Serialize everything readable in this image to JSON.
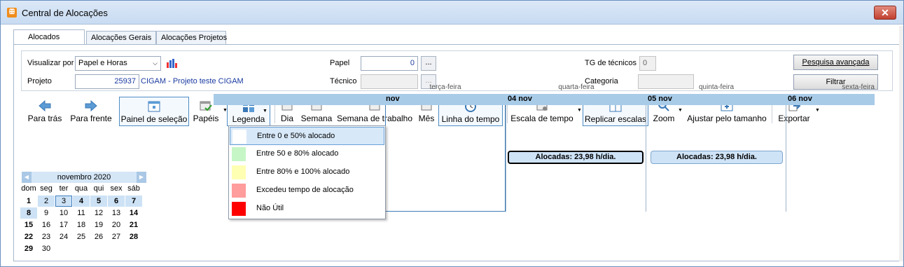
{
  "window": {
    "title": "Central de Alocações",
    "app_icon": "cigam-app-icon",
    "close_label": "✕"
  },
  "tabs": [
    {
      "label": "Alocados",
      "active": true
    },
    {
      "label": "Alocações Gerais",
      "active": false
    },
    {
      "label": "Alocações Projetos",
      "active": false
    }
  ],
  "filters": {
    "visualizar_label": "Visualizar por",
    "visualizar_value": "Papel e Horas",
    "projeto_label": "Projeto",
    "projeto_value": "25937",
    "projeto_name": "CIGAM - Projeto teste CIGAM",
    "papel_label": "Papel",
    "papel_value": "0",
    "tecnico_label": "Técnico",
    "tecnico_value": "",
    "ellipsis": "...",
    "tg_label": "TG de técnicos",
    "tg_value": "0",
    "categoria_label": "Categoria",
    "categoria_value": "",
    "pesquisa_button": "Pesquisa avançada",
    "filtrar_button": "Filtrar"
  },
  "toolbar": {
    "para_tras": "Para trás",
    "para_frente": "Para frente",
    "painel": "Painel de seleção",
    "papeis": "Papéis",
    "legenda": "Legenda",
    "dia": "Dia",
    "semana": "Semana",
    "semana_trabalho": "Semana de trabalho",
    "mes": "Mês",
    "linha_tempo": "Linha do tempo",
    "escala_tempo": "Escala de tempo",
    "replicar_escalas": "Replicar escalas",
    "zoom": "Zoom",
    "ajustar": "Ajustar pelo tamanho",
    "exportar": "Exportar"
  },
  "schedule": {
    "weekdays": [
      "terça-feira",
      "quarta-feira",
      "quinta-feira",
      "sexta-feira"
    ],
    "days": [
      "nov",
      "04 nov",
      "05 nov",
      "06 nov"
    ],
    "allocations": [
      "Alocadas: 23,98 h/dia.",
      "Alocadas: 23,98 h/dia."
    ]
  },
  "calendar": {
    "month": "novembro 2020",
    "weekdays": [
      "dom",
      "seg",
      "ter",
      "qua",
      "qui",
      "sex",
      "sáb"
    ],
    "weeks": [
      [
        "1",
        "2",
        "3",
        "4",
        "5",
        "6",
        "7"
      ],
      [
        "8",
        "9",
        "10",
        "11",
        "12",
        "13",
        "14"
      ],
      [
        "15",
        "16",
        "17",
        "18",
        "19",
        "20",
        "21"
      ],
      [
        "22",
        "23",
        "24",
        "25",
        "26",
        "27",
        "28"
      ],
      [
        "29",
        "30",
        "",
        "",
        "",
        "",
        ""
      ]
    ]
  },
  "legend_menu": [
    {
      "label": "Entre 0 e 50% alocado",
      "color": "#ffffff"
    },
    {
      "label": "Entre 50 e 80% alocado",
      "color": "#c6f5c6"
    },
    {
      "label": "Entre 80% e 100% alocado",
      "color": "#ffffb4"
    },
    {
      "label": "Excedeu tempo de alocação",
      "color": "#ff9c9c"
    },
    {
      "label": "Não Útil",
      "color": "#ff0000"
    }
  ]
}
